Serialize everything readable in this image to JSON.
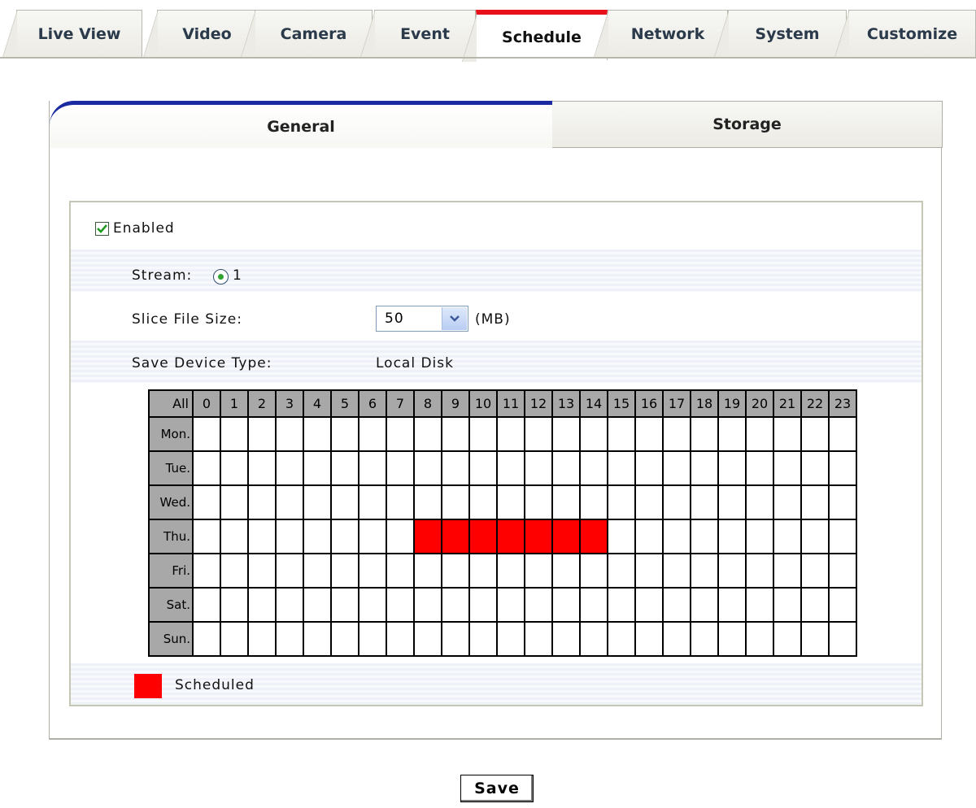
{
  "top_tabs": [
    "Live View",
    "Video",
    "Camera",
    "Event",
    "Schedule",
    "Network",
    "System",
    "Customize"
  ],
  "active_top_tab": "Schedule",
  "sub_tabs": [
    "General",
    "Storage"
  ],
  "active_sub_tab": "General",
  "form": {
    "enabled_label": "Enabled",
    "enabled_checked": true,
    "stream_label": "Stream:",
    "stream_option": "1",
    "slice_label": "Slice File Size:",
    "slice_value": "50",
    "slice_unit": "(MB)",
    "device_label": "Save Device Type:",
    "device_value": "Local Disk"
  },
  "schedule": {
    "corner_label": "All",
    "hours": [
      "0",
      "1",
      "2",
      "3",
      "4",
      "5",
      "6",
      "7",
      "8",
      "9",
      "10",
      "11",
      "12",
      "13",
      "14",
      "15",
      "16",
      "17",
      "18",
      "19",
      "20",
      "21",
      "22",
      "23"
    ],
    "days": [
      "Mon.",
      "Tue.",
      "Wed.",
      "Thu.",
      "Fri.",
      "Sat.",
      "Sun."
    ],
    "scheduled": {
      "Thu.": [
        8,
        9,
        10,
        11,
        12,
        13,
        14
      ]
    }
  },
  "legend": {
    "label": "Scheduled",
    "color": "#ff0000"
  },
  "save_label": "Save",
  "colors": {
    "active_top_tab_accent": "#e8101a",
    "active_sub_tab_accent": "#1a2aa0"
  }
}
